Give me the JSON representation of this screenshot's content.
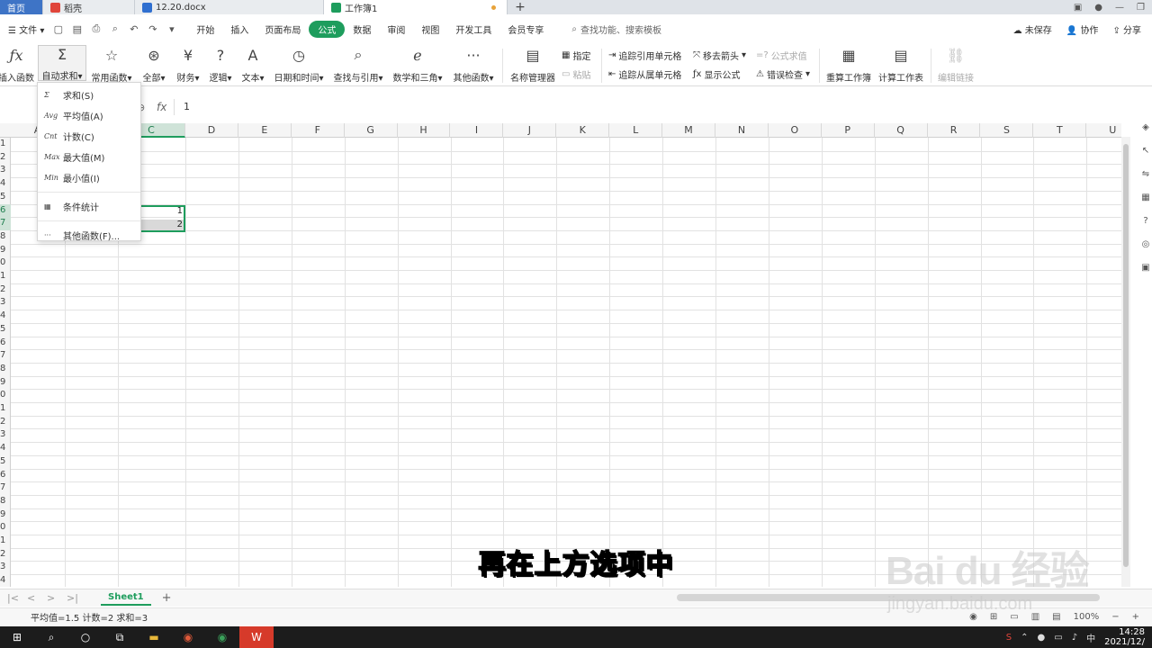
{
  "tabs": {
    "home": "首页",
    "t1": "稻壳",
    "t2": "12.20.docx",
    "active": "工作簿1"
  },
  "menu": {
    "file": "文件",
    "items": [
      "开始",
      "插入",
      "页面布局",
      "公式",
      "数据",
      "审阅",
      "视图",
      "开发工具",
      "会员专享"
    ],
    "search": "查找功能、搜索模板",
    "unsaved": "未保存",
    "collab": "协作",
    "share": "分享"
  },
  "ribbon": {
    "insert_fn": "插入函数",
    "autosum": "自动求和",
    "common": "常用函数",
    "all": "全部",
    "finance": "财务",
    "logic": "逻辑",
    "text": "文本",
    "datetime": "日期和时间",
    "lookup": "查找与引用",
    "math": "数学和三角",
    "other": "其他函数",
    "name_mgr": "名称管理器",
    "specify": "指定",
    "paste": "粘贴",
    "trace_prec": "追踪引用单元格",
    "trace_dep": "追踪从属单元格",
    "remove_arrows": "移去箭头",
    "show_formula": "显示公式",
    "formula_eval": "公式求值",
    "error_check": "错误检查",
    "recalc_book": "重算工作簿",
    "calc_sheet": "计算工作表",
    "edit_links": "编辑链接"
  },
  "formula_bar": {
    "value": "1"
  },
  "columns": [
    "A",
    "B",
    "C",
    "D",
    "E",
    "F",
    "G",
    "H",
    "I",
    "J",
    "K",
    "L",
    "M",
    "N",
    "O",
    "P",
    "Q",
    "R",
    "S",
    "T",
    "U"
  ],
  "rows": [
    "1",
    "2",
    "3",
    "4",
    "5",
    "6",
    "7",
    "8",
    "9",
    "0",
    "1",
    "2",
    "3",
    "4",
    "5",
    "6",
    "7",
    "8",
    "9",
    "0",
    "1",
    "2",
    "3",
    "4",
    "5",
    "6",
    "7",
    "8",
    "9",
    "0",
    "1",
    "2",
    "3",
    "4"
  ],
  "cells": {
    "c6": "1",
    "c7": "2"
  },
  "dropdown": {
    "items": [
      {
        "icon": "Σ",
        "label": "求和(S)"
      },
      {
        "icon": "Avg",
        "label": "平均值(A)"
      },
      {
        "icon": "Cnt",
        "label": "计数(C)"
      },
      {
        "icon": "Max",
        "label": "最大值(M)"
      },
      {
        "icon": "Min",
        "label": "最小值(I)"
      },
      {
        "icon": "▦",
        "label": "条件统计"
      },
      {
        "icon": "···",
        "label": "其他函数(F)..."
      }
    ]
  },
  "sheet": {
    "name": "Sheet1"
  },
  "status": {
    "text": "平均值=1.5  计数=2  求和=3",
    "zoom": "100%"
  },
  "taskbar": {
    "time": "14:28",
    "date": "2021/12/"
  },
  "subtitle": "再在上方选项中",
  "watermark": {
    "logo": "Bai du 经验",
    "url": "jingyan.baidu.com"
  },
  "colors": {
    "accent": "#1e9d5d",
    "tab_home": "#3e74c6",
    "selection_fill": "#cfe3d8"
  }
}
